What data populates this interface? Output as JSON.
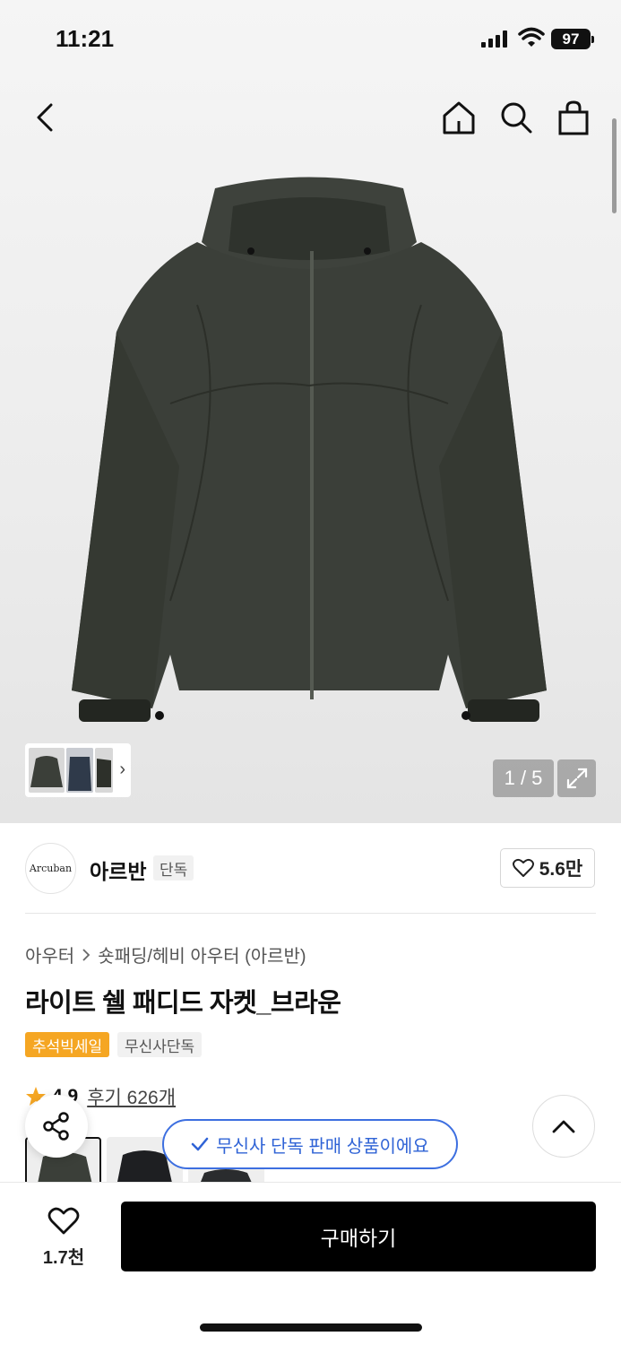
{
  "status_bar": {
    "time": "11:21",
    "battery": "97"
  },
  "nav": {
    "back_icon": "chevron-left-icon",
    "home_icon": "home-icon",
    "search_icon": "search-icon",
    "bag_icon": "shopping-bag-icon"
  },
  "gallery": {
    "counter": "1 / 5",
    "thumb_more": "›"
  },
  "brand": {
    "logo_text": "Arcuban",
    "name": "아르반",
    "tag": "단독",
    "likes": "5.6만"
  },
  "product": {
    "breadcrumb": [
      "아우터",
      "숏패딩/헤비 아우터 (아르반)"
    ],
    "title": "라이트 쉘 패디드 자켓_브라운",
    "badges": {
      "sale": "추석빅세일",
      "exclusive": "무신사단독"
    },
    "rating": "4.9",
    "reviews": "후기 626개"
  },
  "toast": {
    "text": "무신사 단독 판매 상품이에요"
  },
  "bottom": {
    "wish_count": "1.7천",
    "buy_label": "구매하기"
  },
  "colors": {
    "accent_blue": "#2f63d6",
    "sale_orange": "#f5a623",
    "jacket": "#3b3f39"
  }
}
